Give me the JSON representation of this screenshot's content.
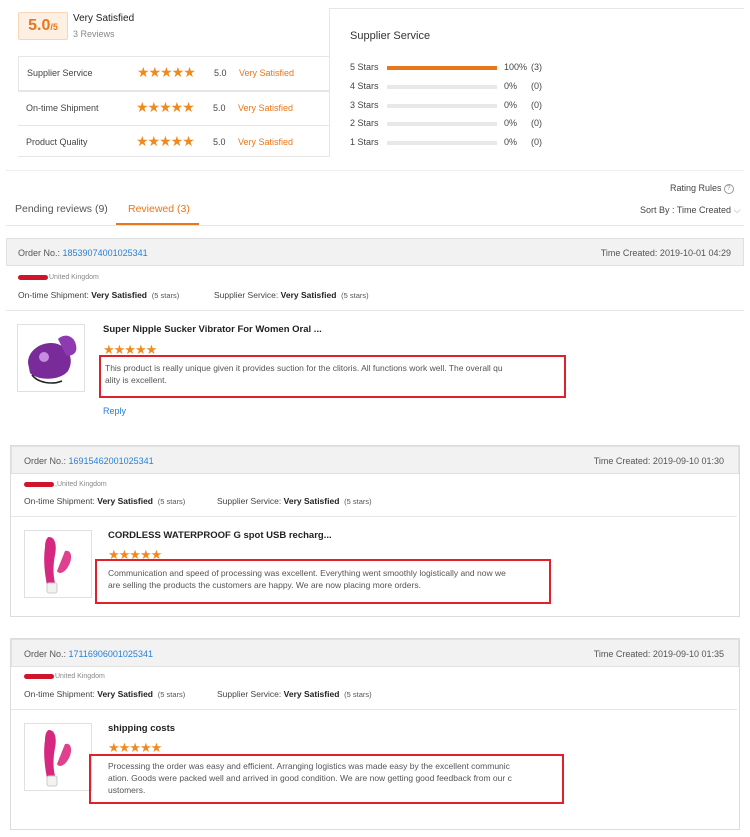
{
  "summary": {
    "score": "5.0",
    "score_suffix": "/5",
    "title": "Very Satisfied",
    "reviews": "3 Reviews",
    "metrics": [
      {
        "label": "Supplier Service",
        "stars": "★★★★★",
        "score": "5.0",
        "word": "Very Satisfied"
      },
      {
        "label": "On-time Shipment",
        "stars": "★★★★★",
        "score": "5.0",
        "word": "Very Satisfied"
      },
      {
        "label": "Product Quality",
        "stars": "★★★★★",
        "score": "5.0",
        "word": "Very Satisfied"
      }
    ]
  },
  "supplier": {
    "title": "Supplier Service",
    "rows": [
      {
        "label": "5 Stars",
        "percent": "100%",
        "count": "(3)",
        "fill": 1.0
      },
      {
        "label": "4 Stars",
        "percent": "0%",
        "count": "(0)",
        "fill": 0
      },
      {
        "label": "3 Stars",
        "percent": "0%",
        "count": "(0)",
        "fill": 0
      },
      {
        "label": "2 Stars",
        "percent": "0%",
        "count": "(0)",
        "fill": 0
      },
      {
        "label": "1 Stars",
        "percent": "0%",
        "count": "(0)",
        "fill": 0
      }
    ]
  },
  "tabs": {
    "rating_rules": "Rating Rules",
    "sort_by": "Sort By : Time Created",
    "pending": "Pending reviews (9)",
    "reviewed": "Reviewed (3)"
  },
  "colors": {
    "accent": "#e8761a",
    "link": "#2a7fd4",
    "highlight": "#e0202a"
  },
  "orders": [
    {
      "order_label": "Order No.:",
      "order_no": "18539074001025341",
      "time_created": "Time Created: 2019-10-01 04:29",
      "buyer": "United Kingdom",
      "ship_label": "On-time Shipment:",
      "ship_value": "Very Satisfied",
      "ship_stars": "(5 stars)",
      "service_label": "Supplier Service:",
      "service_value": "Very Satisfied",
      "service_stars": "(5 stars)",
      "product": "Super Nipple Sucker Vibrator For Women Oral ...",
      "stars": "★★★★★",
      "review_lines": [
        "This product is really unique given it provides suction for the clitoris. All functions work well. The overall qu",
        "ality is excellent."
      ],
      "reply": "Reply"
    },
    {
      "order_label": "Order No.:",
      "order_no": "16915462001025341",
      "time_created": "Time Created: 2019-09-10 01:30",
      "buyer": ",United Kingdom",
      "ship_label": "On-time Shipment:",
      "ship_value": "Very Satisfied",
      "ship_stars": "(5 stars)",
      "service_label": "Supplier Service:",
      "service_value": "Very Satisfied",
      "service_stars": "(5 stars)",
      "product": "CORDLESS WATERPROOF G spot USB recharg...",
      "stars": "★★★★★",
      "review_lines": [
        "Communication and speed of processing was excellent. Everything went smoothly logistically and now we",
        "are selling the products the customers are happy. We are now placing more orders."
      ]
    },
    {
      "order_label": "Order No.:",
      "order_no": "17116906001025341",
      "time_created": "Time Created: 2019-09-10 01:35",
      "buyer": "United Kingdom",
      "ship_label": "On-time Shipment:",
      "ship_value": "Very Satisfied",
      "ship_stars": "(5 stars)",
      "service_label": "Supplier Service:",
      "service_value": "Very Satisfied",
      "service_stars": "(5 stars)",
      "product": "shipping costs",
      "stars": "★★★★★",
      "review_lines": [
        "Processing the order was easy and efficient. Arranging logistics was made easy by the excellent communic",
        "ation. Goods were packed well and arrived in good condition. We are now getting good feedback from our c",
        "ustomers."
      ]
    }
  ]
}
